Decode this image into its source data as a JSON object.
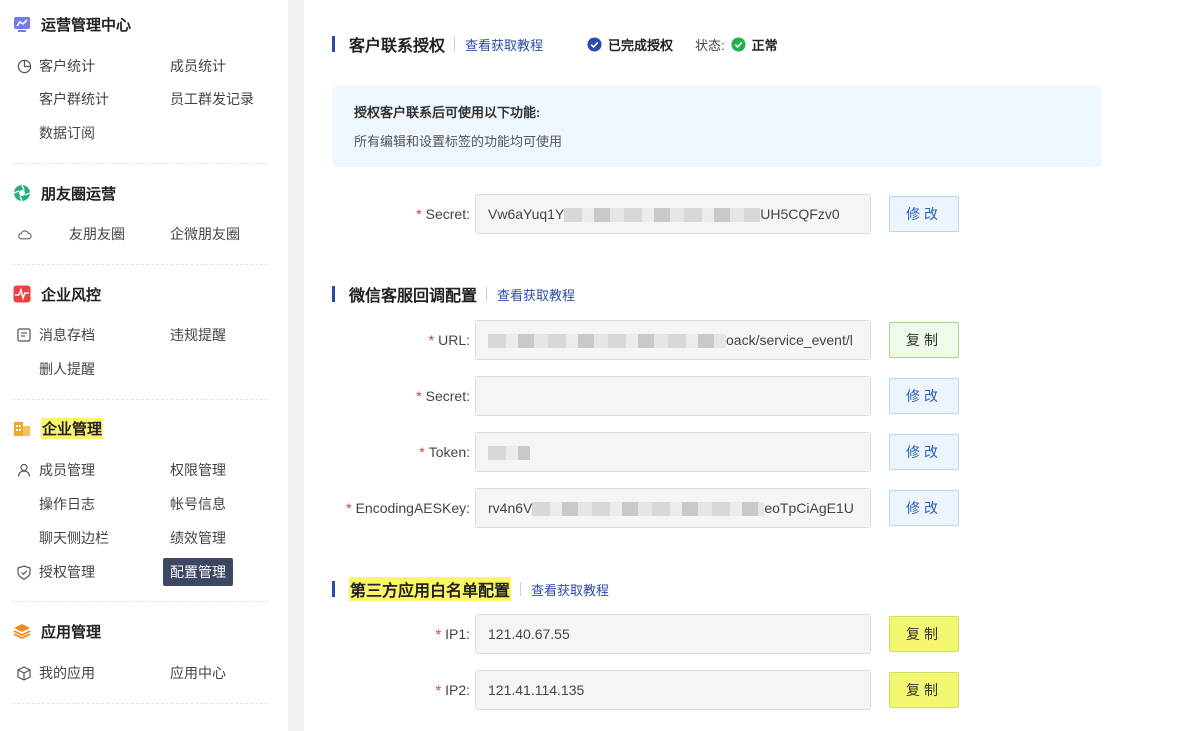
{
  "sidebar": {
    "sections": [
      {
        "title": "运营管理中心",
        "icon": "chart-screen-icon"
      },
      {
        "title": "朋友圈运营",
        "icon": "aperture-icon"
      },
      {
        "title": "企业风控",
        "icon": "pulse-icon"
      },
      {
        "title": "企业管理",
        "icon": "building-icon"
      },
      {
        "title": "应用管理",
        "icon": "layers-icon"
      }
    ],
    "items": {
      "customer_stats": "客户统计",
      "member_stats": "成员统计",
      "group_stats": "客户群统计",
      "group_send_records": "员工群发记录",
      "data_subscribe": "数据订阅",
      "friend_moments": "友朋友圈",
      "wecom_moments": "企微朋友圈",
      "message_archive": "消息存档",
      "violation_alert": "违规提醒",
      "delete_alert": "删人提醒",
      "member_manage": "成员管理",
      "permission_manage": "权限管理",
      "operation_log": "操作日志",
      "account_info": "帐号信息",
      "chat_sidebar": "聊天侧边栏",
      "performance": "绩效管理",
      "auth_manage": "授权管理",
      "config_manage": "配置管理",
      "my_apps": "我的应用",
      "app_center": "应用中心"
    }
  },
  "main": {
    "customer_contact": {
      "title": "客户联系授权",
      "link": "查看获取教程",
      "auth_done": "已完成授权",
      "state_label": "状态:",
      "state_value": "正常",
      "info_title": "授权客户联系后可使用以下功能:",
      "info_desc": "所有编辑和设置标签的功能均可使用",
      "secret_label": "Secret:",
      "secret_prefix": "Vw6aYuq1Y",
      "secret_suffix": "UH5CQFzv0",
      "edit_label": "修改"
    },
    "wechat_callback": {
      "title": "微信客服回调配置",
      "link": "查看获取教程",
      "url_label": "URL:",
      "url_suffix": "oack/service_event/l",
      "secret_label": "Secret:",
      "token_label": "Token:",
      "aes_label": "EncodingAESKey:",
      "aes_prefix": "rv4n6V",
      "aes_suffix": "eoTpCiAgE1U",
      "copy_label": "复制",
      "edit_label": "修改"
    },
    "whitelist": {
      "title": "第三方应用白名单配置",
      "link": "查看获取教程",
      "ip1_label": "IP1:",
      "ip1_value": "121.40.67.55",
      "ip2_label": "IP2:",
      "ip2_value": "121.41.114.135",
      "copy_label": "复制"
    }
  },
  "colors": {
    "accent": "#2e4aa8",
    "highlight": "#fcf56a",
    "active_menu_bg": "#3c4764",
    "success": "#22b14c",
    "required": "#e0352b"
  }
}
